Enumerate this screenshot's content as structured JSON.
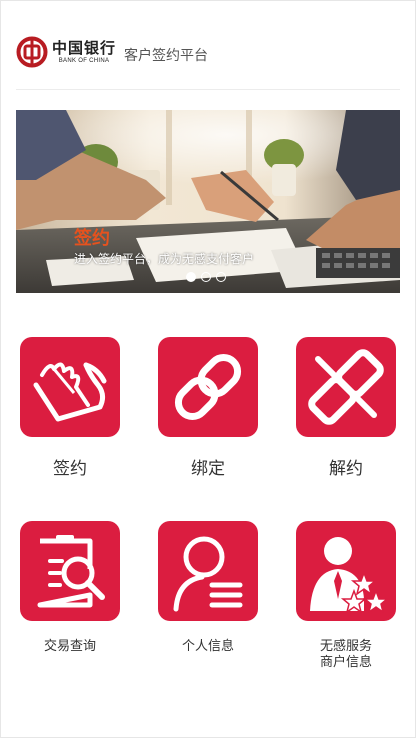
{
  "header": {
    "logo_cn": "中国银行",
    "logo_en": "BANK OF CHINA",
    "title": "客户签约平台"
  },
  "banner": {
    "title": "签约",
    "subtitle": "进入签约平台，成为无感支付客户",
    "slide_count": 3,
    "active_slide": 1
  },
  "menu": {
    "items": [
      {
        "label": "签约",
        "icon": "sign-feather-icon"
      },
      {
        "label": "绑定",
        "icon": "chain-link-icon"
      },
      {
        "label": "解约",
        "icon": "broken-link-icon"
      },
      {
        "label": "交易查询",
        "icon": "document-search-icon"
      },
      {
        "label": "个人信息",
        "icon": "person-list-icon"
      },
      {
        "label_line1": "无感服务",
        "label_line2": "商户信息",
        "icon": "merchant-stars-icon"
      }
    ]
  },
  "colors": {
    "brand_red": "#db1d40",
    "banner_title": "#e6521e"
  }
}
